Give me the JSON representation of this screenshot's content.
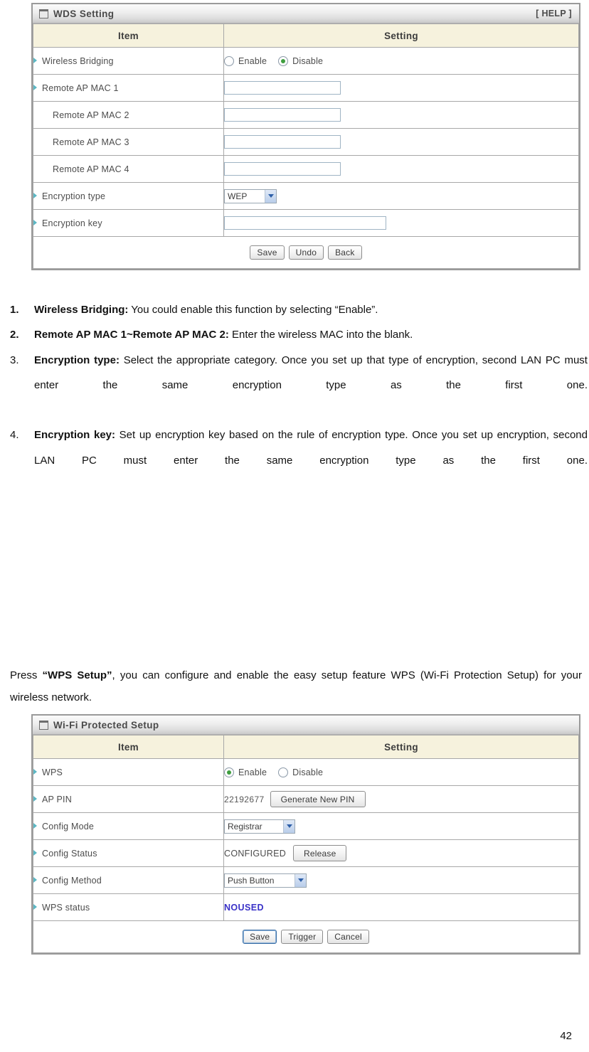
{
  "wds_panel": {
    "title": "WDS Setting",
    "help_label": "[ HELP ]",
    "columns": {
      "item": "Item",
      "setting": "Setting"
    },
    "rows": [
      {
        "label": "Wireless Bridging",
        "bullet": true,
        "type": "radio",
        "options": [
          "Enable",
          "Disable"
        ],
        "selected": "Disable"
      },
      {
        "label": "Remote AP MAC 1",
        "bullet": true,
        "type": "text",
        "value": ""
      },
      {
        "label": "Remote AP MAC 2",
        "bullet": false,
        "type": "text",
        "value": ""
      },
      {
        "label": "Remote AP MAC 3",
        "bullet": false,
        "type": "text",
        "value": ""
      },
      {
        "label": "Remote AP MAC 4",
        "bullet": false,
        "type": "text",
        "value": ""
      },
      {
        "label": "Encryption type",
        "bullet": true,
        "type": "select",
        "value": "WEP"
      },
      {
        "label": "Encryption key",
        "bullet": true,
        "type": "text",
        "value": ""
      }
    ],
    "buttons": [
      {
        "label": "Save",
        "focused": false
      },
      {
        "label": "Undo",
        "focused": false
      },
      {
        "label": "Back",
        "focused": false
      }
    ]
  },
  "instructions": [
    {
      "number": "1.",
      "number_bold": true,
      "lead": "Wireless Bridging:",
      "text": " You could enable this function by selecting “Enable”.",
      "justify": false
    },
    {
      "number": "2.",
      "number_bold": true,
      "lead": "Remote AP MAC 1~Remote AP MAC 2:",
      "text": " Enter the wireless MAC into the blank.",
      "justify": false
    },
    {
      "number": "3.",
      "number_bold": false,
      "lead": "Encryption type:",
      "text": " Select the appropriate category. Once you set up that type of encryption, second LAN PC must enter the same encryption type as the first one.",
      "justify": true
    },
    {
      "number": "4.",
      "number_bold": false,
      "lead": "Encryption key:",
      "text": " Set up encryption key based on the rule of encryption type. Once you set up encryption, second LAN PC must enter the same encryption type as the first one.",
      "justify": true
    }
  ],
  "press_paragraph": {
    "prefix": "Press ",
    "bold": "“WPS Setup”",
    "suffix": ", you can configure and enable the easy setup feature WPS (Wi-Fi Protection Setup) for your wireless network."
  },
  "wps_panel": {
    "title": "Wi-Fi Protected Setup",
    "columns": {
      "item": "Item",
      "setting": "Setting"
    },
    "rows": [
      {
        "label": "WPS",
        "type": "radio",
        "options": [
          "Enable",
          "Disable"
        ],
        "selected": "Enable"
      },
      {
        "label": "AP PIN",
        "type": "pin",
        "value": "22192677",
        "button": "Generate New PIN"
      },
      {
        "label": "Config Mode",
        "type": "select",
        "value": "Registrar"
      },
      {
        "label": "Config Status",
        "type": "status",
        "value": "CONFIGURED",
        "button": "Release"
      },
      {
        "label": "Config Method",
        "type": "select",
        "value": "Push Button"
      },
      {
        "label": "WPS status",
        "type": "wpsstatus",
        "value": "NOUSED"
      }
    ],
    "buttons": [
      {
        "label": "Save",
        "focused": true
      },
      {
        "label": "Trigger",
        "focused": false
      },
      {
        "label": "Cancel",
        "focused": false
      }
    ]
  },
  "page_number": "42",
  "colors": {
    "header_row_bg": "#f6f2dd",
    "bullet": "#5bb7c4",
    "radio_dot": "#3f9e3f",
    "wps_status": "#3a32c8",
    "panel_border": "#9a9a9a"
  }
}
